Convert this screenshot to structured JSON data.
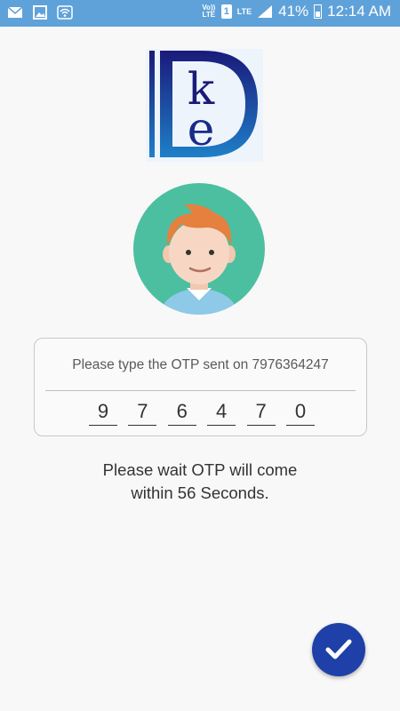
{
  "status_bar": {
    "time": "12:14 AM",
    "battery_percent": "41%",
    "sim_number": "1",
    "volte_label": "Vo)) LTE",
    "lte_label": "LTE",
    "icons": [
      "mail-icon",
      "gallery-icon",
      "wifi-icon",
      "volte-icon",
      "sim-icon",
      "lte-signal-icon",
      "signal-icon",
      "battery-charging-icon"
    ]
  },
  "otp": {
    "prompt": "Please type the OTP sent on 7976364247",
    "digits": [
      "9",
      "7",
      "6",
      "4",
      "7",
      "0"
    ]
  },
  "wait_message": {
    "line1": "Please wait OTP will come",
    "line2": "within 56 Seconds."
  },
  "colors": {
    "status_bar": "#5fa2d9",
    "fab": "#1e40a8",
    "avatar_bg": "#4cbfa0",
    "logo_blue": "#1a2a8a"
  },
  "fab": {
    "icon": "checkmark-icon"
  }
}
